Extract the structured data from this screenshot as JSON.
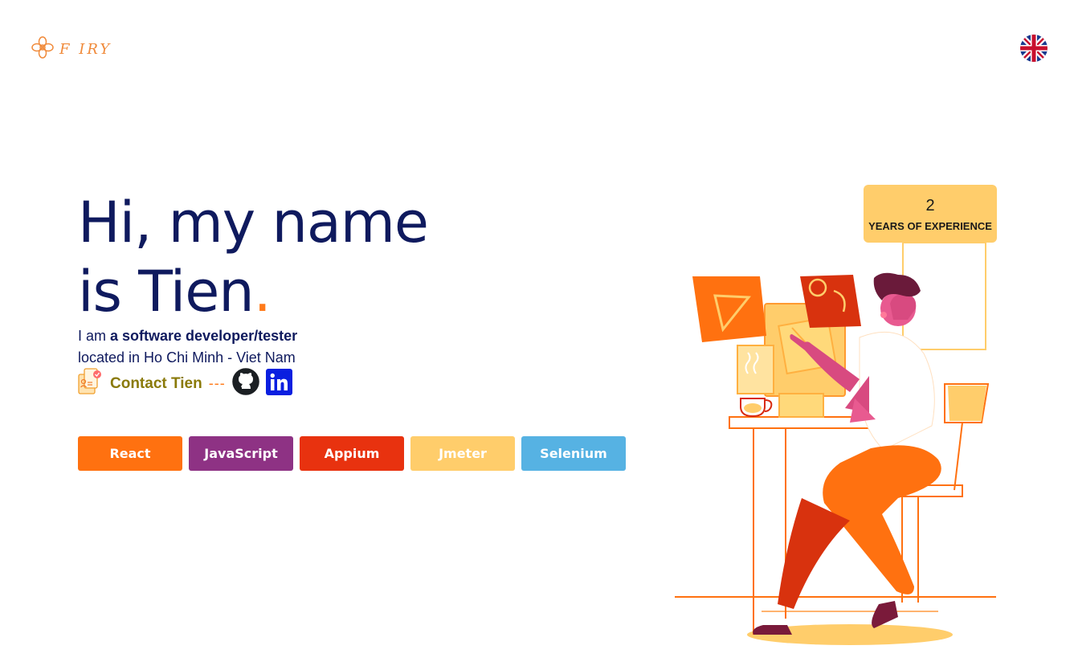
{
  "header": {
    "logo_text": "F  IRY",
    "flag_icon": "uk-flag-icon"
  },
  "hero": {
    "title_line1": "Hi, my name",
    "title_line2": "is Tien",
    "title_dot": ".",
    "intro_prefix": "I am ",
    "intro_role": "a software developer/tester",
    "location": "located in Ho Chi Minh - Viet Nam",
    "contact_label": "Contact Tien",
    "separator": "---"
  },
  "skills": [
    {
      "label": "React",
      "color": "#ff7110"
    },
    {
      "label": "JavaScript",
      "color": "#8e3284"
    },
    {
      "label": "Appium",
      "color": "#e8320f"
    },
    {
      "label": "Jmeter",
      "color": "#ffcd6b"
    },
    {
      "label": "Selenium",
      "color": "#56b2e3"
    }
  ],
  "experience": {
    "years": "2",
    "label": "YEARS OF EXPERIENCE"
  },
  "icons": {
    "contact": "contact-card-icon",
    "github": "github-icon",
    "linkedin": "linkedin-icon"
  },
  "colors": {
    "navy": "#0f1a5e",
    "accent": "#ff7a1a",
    "contact": "#8a7a0a",
    "badge": "#ffcd6b"
  }
}
